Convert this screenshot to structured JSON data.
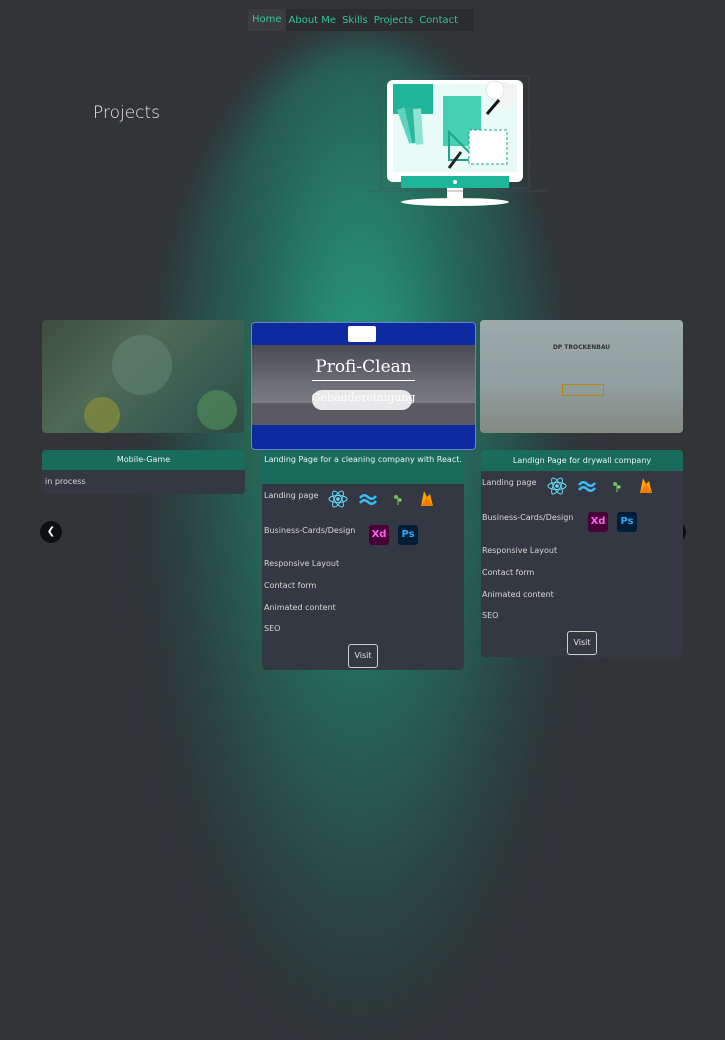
{
  "nav": {
    "items": [
      {
        "label": "Home"
      },
      {
        "label": "About Me"
      },
      {
        "label": "Skills"
      },
      {
        "label": "Projects"
      },
      {
        "label": "Contact"
      }
    ]
  },
  "page_title": "Projects",
  "hero_icon": "design-workstation-illustration",
  "accent_color": "#196b5c",
  "carousel": {
    "prev_icon": "chevron-left-icon",
    "next_icon": "chevron-right-icon",
    "cards": [
      {
        "title": "Mobile-Game",
        "status": "in process"
      },
      {
        "title": "Landing Page for a cleaning company with React.",
        "image": {
          "brand": "Profi-Clean",
          "subtitle": "Gebäudereinigung"
        },
        "features": {
          "landing": "Landing page",
          "business": "Business-Cards/Design",
          "responsive": "Responsive Layout",
          "contact": "Contact form",
          "animated": "Animated content",
          "seo": "SEO"
        },
        "visit": "Visit"
      },
      {
        "title": "Landign Page for drywall company",
        "image": {
          "brand": "DP TROCKENBAU"
        },
        "features": {
          "landing": "Landing page",
          "business": "Business-Cards/Design",
          "responsive": "Responsive Layout",
          "contact": "Contact form",
          "animated": "Animated content",
          "seo": "SEO"
        },
        "visit": "Visit"
      }
    ]
  },
  "tech_icons": [
    "react-icon",
    "tailwind-icon",
    "plant-icon",
    "firebase-icon"
  ],
  "design_icons": {
    "xd": "Xd",
    "ps": "Ps"
  }
}
